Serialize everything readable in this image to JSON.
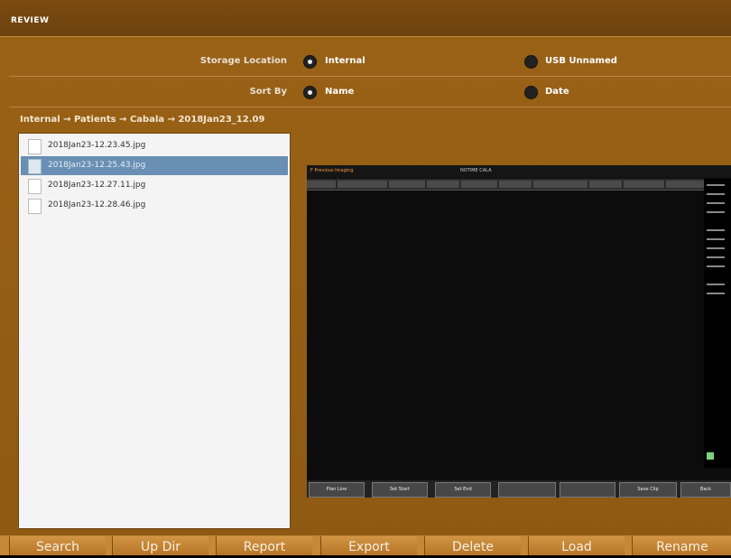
{
  "window": {
    "title": "REVIEW"
  },
  "storage": {
    "label": "Storage Location",
    "options": [
      {
        "label": "Internal",
        "selected": true
      },
      {
        "label": "USB Unnamed",
        "selected": false
      }
    ]
  },
  "sort": {
    "label": "Sort By",
    "options": [
      {
        "label": "Name",
        "selected": true
      },
      {
        "label": "Date",
        "selected": false
      }
    ]
  },
  "breadcrumb": "Internal → Patients → Cabala → 2018Jan23_12.09",
  "files": [
    {
      "name": "2018Jan23-12.23.45.jpg",
      "selected": false
    },
    {
      "name": "2018Jan23-12.25.43.jpg",
      "selected": true
    },
    {
      "name": "2018Jan23-12.27.11.jpg",
      "selected": false
    },
    {
      "name": "2018Jan23-12.28.46.jpg",
      "selected": false
    }
  ],
  "preview": {
    "header_left": "F  Previous Imaging",
    "header_mid": "NOTIME  CALA",
    "buttons": [
      "Plan Line",
      "Set Start",
      "Set End",
      "",
      "",
      "Save Clip",
      "Back"
    ]
  },
  "toolbar": {
    "buttons": [
      "Search",
      "Up Dir",
      "Report",
      "Export",
      "Delete",
      "Load",
      "Rename"
    ]
  },
  "colors": {
    "panel": "#9a6216",
    "titlebar": "#6d420e",
    "selection": "#6a8fb5",
    "button": "#c48837"
  }
}
